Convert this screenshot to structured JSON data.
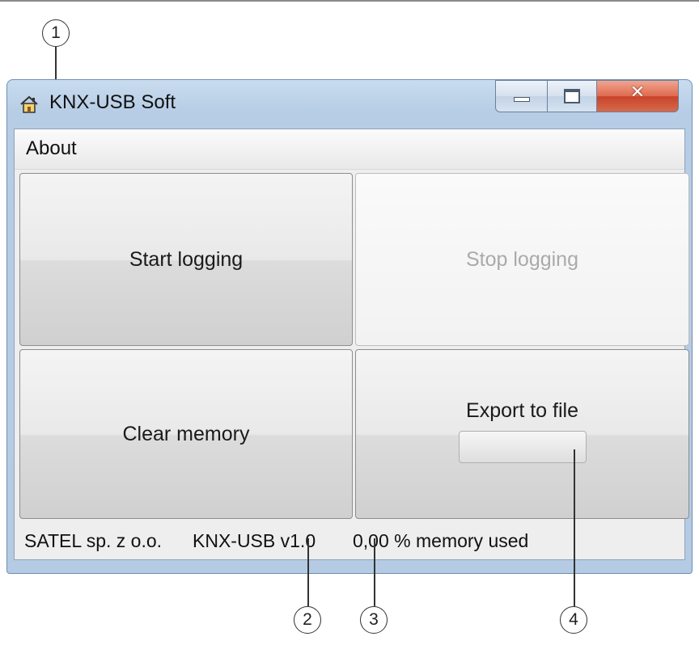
{
  "window": {
    "title": "KNX-USB Soft",
    "icon": "home-icon",
    "controls": {
      "minimize": "minimize-icon",
      "maximize": "maximize-icon",
      "close": "close-icon"
    }
  },
  "menu": {
    "about": "About"
  },
  "buttons": {
    "start": "Start logging",
    "stop": "Stop logging",
    "clear": "Clear memory",
    "export": "Export to file"
  },
  "export_progress": 0,
  "status": {
    "company": "SATEL sp. z o.o.",
    "version": "KNX-USB v1.0",
    "memory": "0,00 % memory used"
  },
  "callouts": [
    "1",
    "2",
    "3",
    "4"
  ],
  "colors": {
    "close_button": "#d0502f",
    "disabled_text": "#aaaaaa",
    "frame": "#b7cde5"
  }
}
